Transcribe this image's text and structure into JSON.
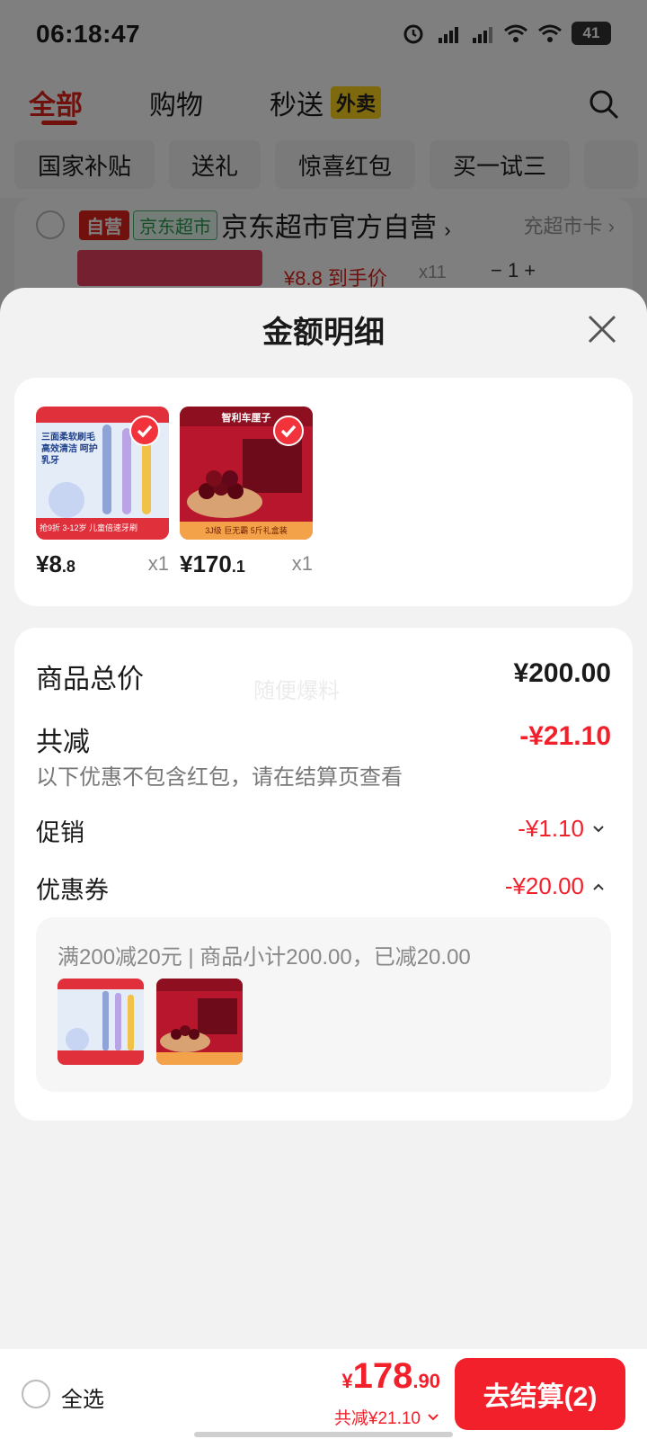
{
  "status": {
    "time": "06:18:47",
    "battery": "41",
    "signal_1": "5G",
    "signal_2": "5G"
  },
  "tabs": {
    "all": "全部",
    "shopping": "购物",
    "instant": "秒送",
    "waimai": "外卖"
  },
  "chips": [
    "国家补贴",
    "送礼",
    "惊喜红包",
    "买一试三"
  ],
  "store": {
    "tag_self": "自营",
    "tag_market": "京东超市",
    "name": "京东超市官方自营",
    "link": "充超市卡",
    "peek_price": "¥8.8 到手价",
    "peek_qty": "x11",
    "peek_stepper": "−   1   +"
  },
  "sheet": {
    "title": "金额明细",
    "products": [
      {
        "price_int": "¥8",
        "price_dec": ".8",
        "qty": "x1",
        "image_text": "三面柔软刷毛 高效清洁 呵护乳牙",
        "image_footer": "抢9折 3-12岁 儿童倍速牙刷"
      },
      {
        "price_int": "¥170",
        "price_dec": ".1",
        "qty": "x1",
        "image_text": "智利车厘子",
        "image_footer": "3J级 巨无霸 5斤礼盒装"
      }
    ],
    "watermark": "随便爆料",
    "total_label": "商品总价",
    "total_value": "¥200.00",
    "discount_label": "共减",
    "discount_value": "-¥21.10",
    "discount_note": "以下优惠不包含红包，请在结算页查看",
    "promo_label": "促销",
    "promo_value": "-¥1.10",
    "coupon_label": "优惠券",
    "coupon_value": "-¥20.00",
    "coupon_desc": "满200减20元 | 商品小计200.00，已减20.00"
  },
  "bottom": {
    "select_all": "全选",
    "total_yen": "¥",
    "total_int": "178",
    "total_dec": ".90",
    "total_discount": "共减¥21.10",
    "checkout": "去结算(2)"
  },
  "colors": {
    "accent": "#f2202b",
    "brand_red": "#e2231a"
  }
}
